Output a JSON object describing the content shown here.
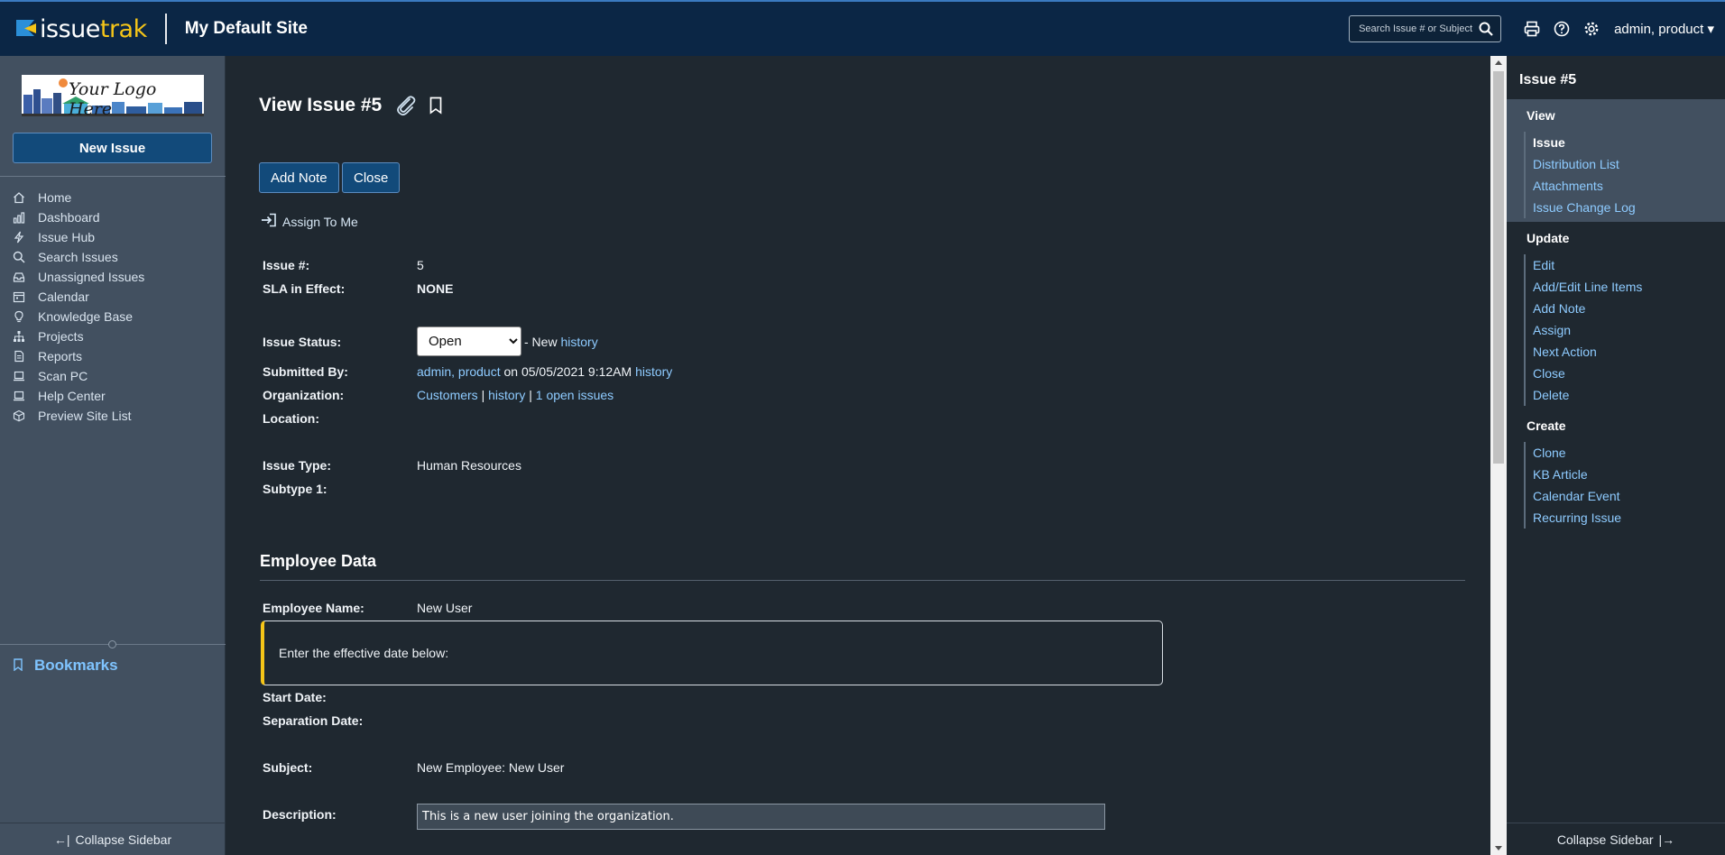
{
  "header": {
    "brand_part1": "issue",
    "brand_part2": "trak",
    "site_title": "My Default Site",
    "search_placeholder": "Search Issue # or Subject",
    "user_menu": "admin, product ▾"
  },
  "sidebar": {
    "logo_text": "Your Logo Here",
    "new_issue_label": "New Issue",
    "nav": [
      {
        "label": "Home",
        "icon": "home-icon"
      },
      {
        "label": "Dashboard",
        "icon": "dashboard-icon"
      },
      {
        "label": "Issue Hub",
        "icon": "lightning-icon"
      },
      {
        "label": "Search Issues",
        "icon": "search-icon"
      },
      {
        "label": "Unassigned Issues",
        "icon": "inbox-icon"
      },
      {
        "label": "Calendar",
        "icon": "calendar-icon"
      },
      {
        "label": "Knowledge Base",
        "icon": "lightbulb-icon"
      },
      {
        "label": "Projects",
        "icon": "sitemap-icon"
      },
      {
        "label": "Reports",
        "icon": "report-icon"
      },
      {
        "label": "Scan PC",
        "icon": "laptop-icon"
      },
      {
        "label": "Help Center",
        "icon": "laptop-icon"
      },
      {
        "label": "Preview Site List",
        "icon": "cube-icon"
      }
    ],
    "bookmarks_label": "Bookmarks",
    "collapse_label": "Collapse Sidebar"
  },
  "main": {
    "title": "View Issue #5",
    "add_note_label": "Add Note",
    "close_label": "Close",
    "assign_to_me_label": "Assign To Me",
    "fields": {
      "issue_no_label": "Issue #:",
      "issue_no_value": "5",
      "sla_label": "SLA in Effect:",
      "sla_value": "NONE",
      "status_label": "Issue Status:",
      "status_options": [
        "Open"
      ],
      "status_suffix": "- New",
      "status_history": "history",
      "submitted_label": "Submitted By:",
      "submitted_user": "admin, product",
      "submitted_on": "on 05/05/2021 9:12AM",
      "submitted_history": "history",
      "org_label": "Organization:",
      "org_value": "Customers",
      "org_history": "history",
      "org_open": "1 open issues",
      "location_label": "Location:",
      "type_label": "Issue Type:",
      "type_value": "Human Resources",
      "subtype_label": "Subtype 1:"
    },
    "employee": {
      "section_title": "Employee Data",
      "name_label": "Employee Name:",
      "name_value": "New User",
      "callout_text": "Enter the effective date below:",
      "start_label": "Start Date:",
      "separation_label": "Separation Date:",
      "subject_label": "Subject:",
      "subject_value": "New Employee: New User",
      "description_label": "Description:",
      "description_value": "This is a new user joining the organization."
    }
  },
  "right_sidebar": {
    "title": "Issue #5",
    "view": {
      "heading": "View",
      "items": [
        "Issue",
        "Distribution List",
        "Attachments",
        "Issue Change Log"
      ]
    },
    "update": {
      "heading": "Update",
      "items": [
        "Edit",
        "Add/Edit Line Items",
        "Add Note",
        "Assign",
        "Next Action",
        "Close",
        "Delete"
      ]
    },
    "create": {
      "heading": "Create",
      "items": [
        "Clone",
        "KB Article",
        "Calendar Event",
        "Recurring Issue"
      ]
    },
    "collapse_label": "Collapse Sidebar"
  }
}
